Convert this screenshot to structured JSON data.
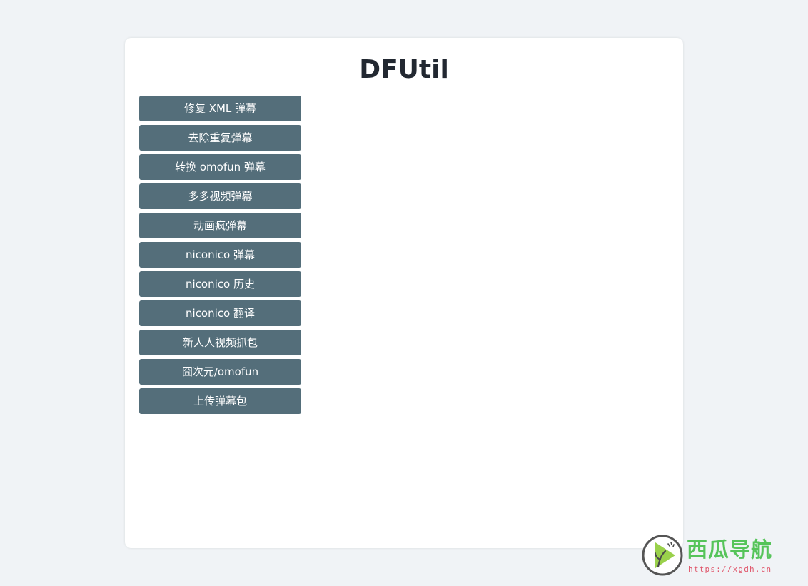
{
  "app": {
    "title": "DFUtil"
  },
  "menu": {
    "items": [
      {
        "id": "fix-xml",
        "label": "修复 XML 弹幕"
      },
      {
        "id": "dedupe",
        "label": "去除重复弹幕"
      },
      {
        "id": "convert-omofun",
        "label": "转换 omofun 弹幕"
      },
      {
        "id": "duoduo",
        "label": "多多视频弹幕"
      },
      {
        "id": "anime-crazy",
        "label": "动画疯弹幕"
      },
      {
        "id": "niconico-danmaku",
        "label": "niconico 弹幕"
      },
      {
        "id": "niconico-history",
        "label": "niconico 历史"
      },
      {
        "id": "niconico-translate",
        "label": "niconico 翻译"
      },
      {
        "id": "renren-capture",
        "label": "新人人视频抓包"
      },
      {
        "id": "jiongciyuan",
        "label": "囧次元/omofun"
      },
      {
        "id": "upload-pack",
        "label": "上传弹幕包"
      }
    ]
  },
  "watermark": {
    "name": "西瓜导航",
    "url": "https://xgdh.cn",
    "icon": "play-leaf-icon"
  },
  "colors": {
    "background": "#f0f3f6",
    "card": "#ffffff",
    "button": "#546e7a",
    "button_text": "#ffffff",
    "title": "#222831",
    "watermark_green": "#56c45a",
    "watermark_url": "#e0556a"
  }
}
